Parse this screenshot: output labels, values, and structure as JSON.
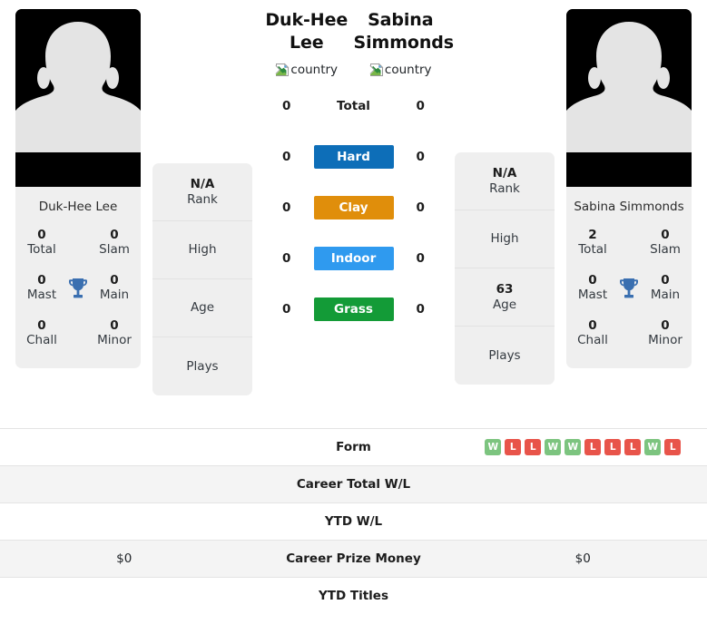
{
  "players": {
    "left": {
      "name": "Duk-Hee Lee",
      "card_name": "Duk-Hee Lee",
      "country_alt": "country",
      "photo_alt": "player photo",
      "rank": "N/A",
      "rank_label": "Rank",
      "high_value": "",
      "high_label": "High",
      "age_value": "",
      "age_label": "Age",
      "plays_value": "",
      "plays_label": "Plays",
      "titles": {
        "total": "0",
        "slam": "0",
        "mast": "0",
        "main": "0",
        "chall": "0",
        "minor": "0"
      },
      "surfaces": {
        "total": "0",
        "hard": "0",
        "clay": "0",
        "indoor": "0",
        "grass": "0"
      },
      "career_total_wl": "",
      "ytd_wl": "",
      "career_prize_money": "$0",
      "ytd_titles": ""
    },
    "right": {
      "name": "Sabina Simmonds",
      "card_name": "Sabina Simmonds",
      "country_alt": "country",
      "photo_alt": "player photo",
      "rank": "N/A",
      "rank_label": "Rank",
      "high_value": "",
      "high_label": "High",
      "age_value": "63",
      "age_label": "Age",
      "plays_value": "",
      "plays_label": "Plays",
      "titles": {
        "total": "2",
        "slam": "0",
        "mast": "0",
        "main": "0",
        "chall": "0",
        "minor": "0"
      },
      "surfaces": {
        "total": "0",
        "hard": "0",
        "clay": "0",
        "indoor": "0",
        "grass": "0"
      },
      "career_total_wl": "",
      "ytd_wl": "",
      "career_prize_money": "$0",
      "ytd_titles": ""
    }
  },
  "titles_labels": {
    "total": "Total",
    "slam": "Slam",
    "mast": "Mast",
    "main": "Main",
    "chall": "Chall",
    "minor": "Minor"
  },
  "surface_rows": [
    {
      "key": "total",
      "label": "Total",
      "color": "",
      "plain": true
    },
    {
      "key": "hard",
      "label": "Hard",
      "color": "#0d6eb8",
      "plain": false
    },
    {
      "key": "clay",
      "label": "Clay",
      "color": "#e08e0b",
      "plain": false
    },
    {
      "key": "indoor",
      "label": "Indoor",
      "color": "#2f9aef",
      "plain": false
    },
    {
      "key": "grass",
      "label": "Grass",
      "color": "#139b37",
      "plain": false
    }
  ],
  "table_rows": [
    {
      "label": "Form",
      "left_key": "form",
      "right_key": "form",
      "striped": false
    },
    {
      "label": "Career Total W/L",
      "left_key": "career_total_wl",
      "right_key": "career_total_wl",
      "striped": true
    },
    {
      "label": "YTD W/L",
      "left_key": "ytd_wl",
      "right_key": "ytd_wl",
      "striped": false
    },
    {
      "label": "Career Prize Money",
      "left_key": "career_prize_money",
      "right_key": "career_prize_money",
      "striped": true
    },
    {
      "label": "YTD Titles",
      "left_key": "ytd_titles",
      "right_key": "ytd_titles",
      "striped": false
    }
  ],
  "form": {
    "left": [],
    "right": [
      "W",
      "L",
      "L",
      "W",
      "W",
      "L",
      "L",
      "L",
      "W",
      "L"
    ]
  },
  "colors": {
    "win": "#7cc47f",
    "loss": "#e8544a",
    "card_bg": "#efefef",
    "stripe_bg": "#f4f4f4",
    "trophy": "#3a6fb0"
  },
  "icons": {
    "trophy": "trophy-icon",
    "broken_image": "broken-image-icon",
    "silhouette": "person-silhouette-icon"
  }
}
